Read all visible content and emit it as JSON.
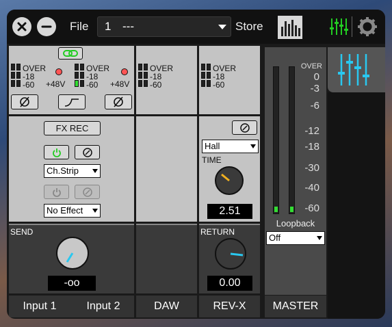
{
  "topbar": {
    "file_label": "File",
    "file_number": "1",
    "file_name": "---",
    "store_label": "Store",
    "close_icon": "close-icon",
    "minimize_icon": "minimize-icon",
    "mixer_icon": "mixer-icon",
    "settings_icon": "gear-icon"
  },
  "meters": {
    "over": "OVER",
    "m18": "-18",
    "m60": "-60",
    "phantom": "+48V"
  },
  "input": {
    "fx_rec_label": "FX REC",
    "chstrip_value": "Ch.Strip",
    "effect_value": "No Effect",
    "send_label": "SEND",
    "send_value": "-oo",
    "input1_label": "Input 1",
    "input2_label": "Input 2"
  },
  "daw": {
    "label": "DAW"
  },
  "revx": {
    "type_value": "Hall",
    "time_label": "TIME",
    "time_value": "2.51",
    "return_label": "RETURN",
    "return_value": "0.00",
    "label": "REV-X"
  },
  "master": {
    "scale": [
      "OVER",
      "0",
      "-3",
      "-6",
      "-12",
      "-18",
      "-30",
      "-40",
      "-60"
    ],
    "loopback_label": "Loopback",
    "loopback_value": "Off",
    "label": "MASTER"
  },
  "colors": {
    "accent_green": "#22cc22",
    "accent_cyan": "#29c8f0",
    "clip_red": "#ff5555"
  }
}
